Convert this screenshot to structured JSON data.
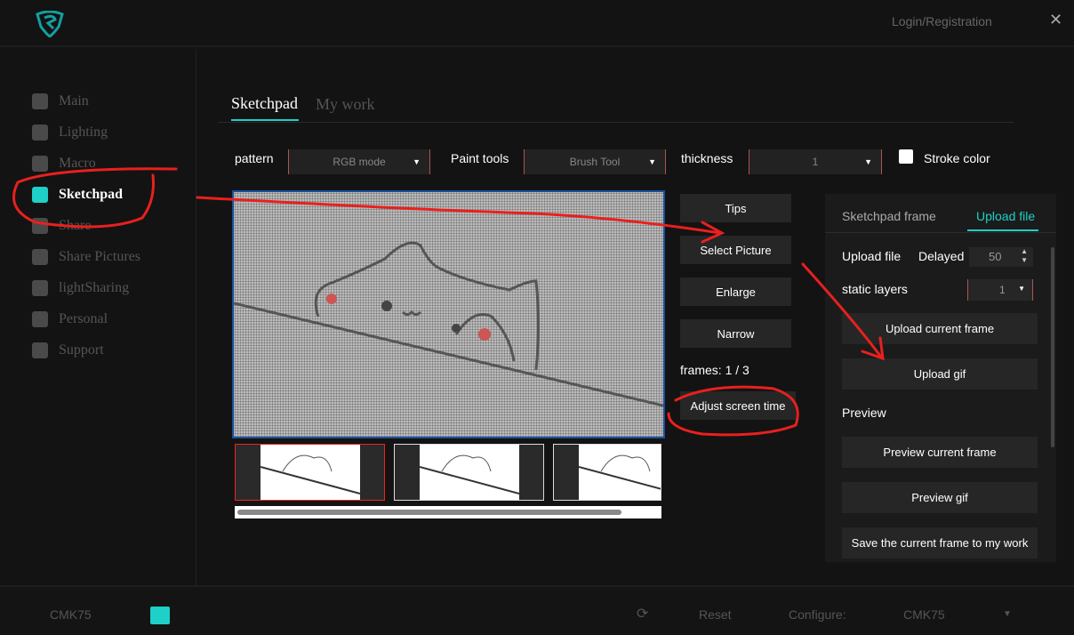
{
  "header": {
    "login": "Login/Registration",
    "close": "✕"
  },
  "sidebar": {
    "items": [
      {
        "label": "Main",
        "icon": "home-icon"
      },
      {
        "label": "Lighting",
        "icon": "bulb-icon"
      },
      {
        "label": "Macro",
        "icon": "macro-icon"
      },
      {
        "label": "Sketchpad",
        "icon": "sketchpad-icon"
      },
      {
        "label": "Share",
        "icon": "cube-icon"
      },
      {
        "label": "Share Pictures",
        "icon": "picture-icon"
      },
      {
        "label": "lightSharing",
        "icon": "cube-icon"
      },
      {
        "label": "Personal",
        "icon": "person-icon"
      },
      {
        "label": "Support",
        "icon": "heart-icon"
      }
    ]
  },
  "tabs": [
    "Sketchpad",
    "My work"
  ],
  "toolbar": {
    "pattern_label": "pattern",
    "pattern_value": "RGB mode",
    "paint_label": "Paint tools",
    "paint_value": "Brush Tool",
    "thickness_label": "thickness",
    "thickness_value": "1",
    "stroke_label": "Stroke color"
  },
  "buttons": {
    "tips": "Tips",
    "select": "Select Picture",
    "enlarge": "Enlarge",
    "narrow": "Narrow",
    "frames": "frames: 1 / 3",
    "adjust": "Adjust screen time"
  },
  "panel": {
    "tabs": [
      "Sketchpad frame",
      "Upload file"
    ],
    "upload_label": "Upload file",
    "delayed_label": "Delayed",
    "delayed_value": "50",
    "static_label": "static layers",
    "static_value": "1",
    "upload_frame": "Upload current frame",
    "upload_gif": "Upload gif",
    "preview_label": "Preview",
    "preview_frame": "Preview current frame",
    "preview_gif": "Preview gif",
    "save": "Save the current frame to my work"
  },
  "footer": {
    "device": "CMK75",
    "reset": "Reset",
    "configure": "Configure:",
    "config_value": "CMK75"
  },
  "colors": {
    "accent": "#1ed0c8",
    "annotation": "#e8201e"
  }
}
